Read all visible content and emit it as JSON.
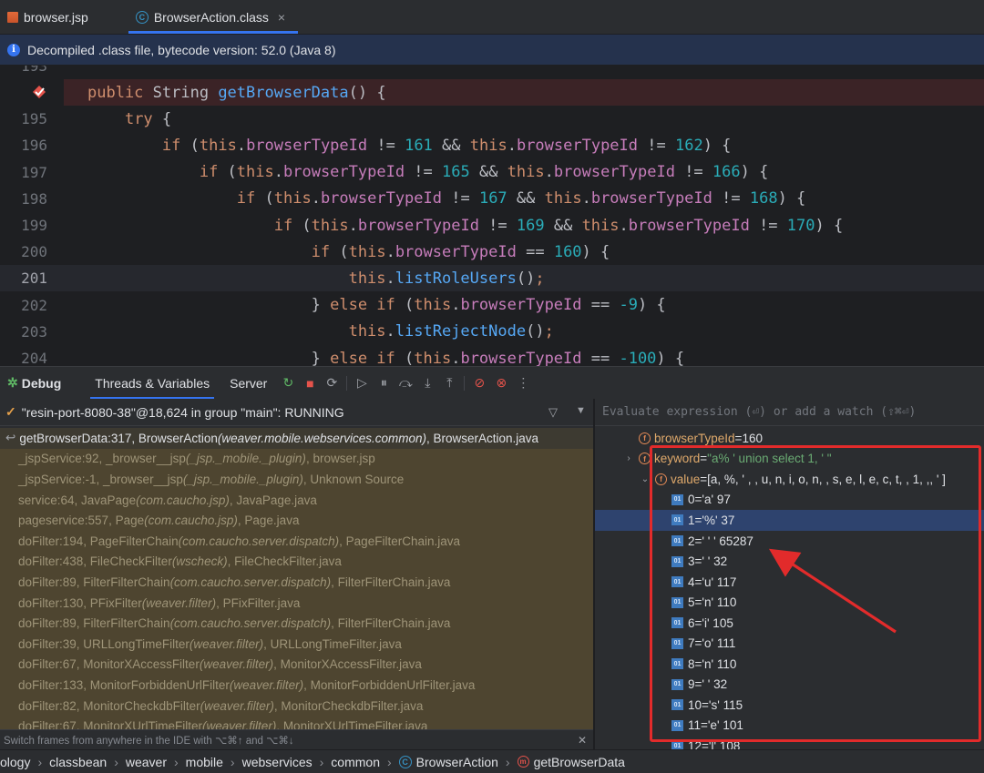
{
  "tabs": [
    {
      "label": "browser.jsp",
      "icon": "jsp-file-icon"
    },
    {
      "label": "BrowserAction.class",
      "icon": "class-icon",
      "active": true
    }
  ],
  "banner": {
    "text": "Decompiled .class file, bytecode version: 52.0 (Java 8)"
  },
  "editor": {
    "partial_top_number": "193",
    "lines": [
      {
        "num": "",
        "breakpoint": true,
        "tokens": [
          [
            "kw",
            "public "
          ],
          [
            "pl",
            "String "
          ],
          [
            "fn",
            "getBrowserData"
          ],
          [
            "pl",
            "() {"
          ]
        ]
      },
      {
        "num": "195",
        "tokens": [
          [
            "pl",
            "    "
          ],
          [
            "kw",
            "try "
          ],
          [
            "pl",
            "{"
          ]
        ]
      },
      {
        "num": "196",
        "tokens": [
          [
            "pl",
            "        "
          ],
          [
            "kw",
            "if "
          ],
          [
            "pl",
            "("
          ],
          [
            "kw",
            "this"
          ],
          [
            "pl",
            "."
          ],
          [
            "fld",
            "browserTypeId"
          ],
          [
            "pl",
            " != "
          ],
          [
            "num",
            "161"
          ],
          [
            "pl",
            " && "
          ],
          [
            "kw",
            "this"
          ],
          [
            "pl",
            "."
          ],
          [
            "fld",
            "browserTypeId"
          ],
          [
            "pl",
            " != "
          ],
          [
            "num",
            "162"
          ],
          [
            "pl",
            ") {"
          ]
        ]
      },
      {
        "num": "197",
        "tokens": [
          [
            "pl",
            "            "
          ],
          [
            "kw",
            "if "
          ],
          [
            "pl",
            "("
          ],
          [
            "kw",
            "this"
          ],
          [
            "pl",
            "."
          ],
          [
            "fld",
            "browserTypeId"
          ],
          [
            "pl",
            " != "
          ],
          [
            "num",
            "165"
          ],
          [
            "pl",
            " && "
          ],
          [
            "kw",
            "this"
          ],
          [
            "pl",
            "."
          ],
          [
            "fld",
            "browserTypeId"
          ],
          [
            "pl",
            " != "
          ],
          [
            "num",
            "166"
          ],
          [
            "pl",
            ") {"
          ]
        ]
      },
      {
        "num": "198",
        "tokens": [
          [
            "pl",
            "                "
          ],
          [
            "kw",
            "if "
          ],
          [
            "pl",
            "("
          ],
          [
            "kw",
            "this"
          ],
          [
            "pl",
            "."
          ],
          [
            "fld",
            "browserTypeId"
          ],
          [
            "pl",
            " != "
          ],
          [
            "num",
            "167"
          ],
          [
            "pl",
            " && "
          ],
          [
            "kw",
            "this"
          ],
          [
            "pl",
            "."
          ],
          [
            "fld",
            "browserTypeId"
          ],
          [
            "pl",
            " != "
          ],
          [
            "num",
            "168"
          ],
          [
            "pl",
            ") {"
          ]
        ]
      },
      {
        "num": "199",
        "tokens": [
          [
            "pl",
            "                    "
          ],
          [
            "kw",
            "if "
          ],
          [
            "pl",
            "("
          ],
          [
            "kw",
            "this"
          ],
          [
            "pl",
            "."
          ],
          [
            "fld",
            "browserTypeId"
          ],
          [
            "pl",
            " != "
          ],
          [
            "num",
            "169"
          ],
          [
            "pl",
            " && "
          ],
          [
            "kw",
            "this"
          ],
          [
            "pl",
            "."
          ],
          [
            "fld",
            "browserTypeId"
          ],
          [
            "pl",
            " != "
          ],
          [
            "num",
            "170"
          ],
          [
            "pl",
            ") {"
          ]
        ]
      },
      {
        "num": "200",
        "tokens": [
          [
            "pl",
            "                        "
          ],
          [
            "kw",
            "if "
          ],
          [
            "pl",
            "("
          ],
          [
            "kw",
            "this"
          ],
          [
            "pl",
            "."
          ],
          [
            "fld",
            "browserTypeId"
          ],
          [
            "pl",
            " == "
          ],
          [
            "num",
            "160"
          ],
          [
            "pl",
            ") {"
          ]
        ]
      },
      {
        "num": "201",
        "current": true,
        "tokens": [
          [
            "pl",
            "                            "
          ],
          [
            "kw",
            "this"
          ],
          [
            "pl",
            "."
          ],
          [
            "fn",
            "listRoleUsers"
          ],
          [
            "pl",
            "()"
          ],
          [
            "kw",
            ";"
          ]
        ]
      },
      {
        "num": "202",
        "tokens": [
          [
            "pl",
            "                        } "
          ],
          [
            "kw",
            "else if "
          ],
          [
            "pl",
            "("
          ],
          [
            "kw",
            "this"
          ],
          [
            "pl",
            "."
          ],
          [
            "fld",
            "browserTypeId"
          ],
          [
            "pl",
            " == "
          ],
          [
            "num",
            "-9"
          ],
          [
            "pl",
            ") {"
          ]
        ]
      },
      {
        "num": "203",
        "tokens": [
          [
            "pl",
            "                            "
          ],
          [
            "kw",
            "this"
          ],
          [
            "pl",
            "."
          ],
          [
            "fn",
            "listRejectNode"
          ],
          [
            "pl",
            "()"
          ],
          [
            "kw",
            ";"
          ]
        ]
      },
      {
        "num": "204",
        "tokens": [
          [
            "pl",
            "                        } "
          ],
          [
            "kw",
            "else if "
          ],
          [
            "pl",
            "("
          ],
          [
            "kw",
            "this"
          ],
          [
            "pl",
            "."
          ],
          [
            "fld",
            "browserTypeId"
          ],
          [
            "pl",
            " == "
          ],
          [
            "num",
            "-100"
          ],
          [
            "pl",
            ") {"
          ]
        ]
      }
    ]
  },
  "debugbar": {
    "title": "Debug",
    "tabs": [
      "Threads & Variables",
      "Server"
    ]
  },
  "thread": {
    "label": "\"resin-port-8080-38\"@18,624 in group \"main\": RUNNING"
  },
  "frames": [
    {
      "method": "getBrowserData:317, BrowserAction",
      "pkg": "(weaver.mobile.webservices.common)",
      "file": ", BrowserAction.java"
    },
    {
      "method": "_jspService:92, _browser__jsp",
      "pkg": "(_jsp._mobile._plugin)",
      "file": ", browser.jsp"
    },
    {
      "method": "_jspService:-1, _browser__jsp",
      "pkg": "(_jsp._mobile._plugin)",
      "file": ", Unknown Source"
    },
    {
      "method": "service:64, JavaPage",
      "pkg": "(com.caucho.jsp)",
      "file": ", JavaPage.java"
    },
    {
      "method": "pageservice:557, Page",
      "pkg": "(com.caucho.jsp)",
      "file": ", Page.java"
    },
    {
      "method": "doFilter:194, PageFilterChain",
      "pkg": "(com.caucho.server.dispatch)",
      "file": ", PageFilterChain.java"
    },
    {
      "method": "doFilter:438, FileCheckFilter",
      "pkg": "(wscheck)",
      "file": ", FileCheckFilter.java"
    },
    {
      "method": "doFilter:89, FilterFilterChain",
      "pkg": "(com.caucho.server.dispatch)",
      "file": ", FilterFilterChain.java"
    },
    {
      "method": "doFilter:130, PFixFilter",
      "pkg": "(weaver.filter)",
      "file": ", PFixFilter.java"
    },
    {
      "method": "doFilter:89, FilterFilterChain",
      "pkg": "(com.caucho.server.dispatch)",
      "file": ", FilterFilterChain.java"
    },
    {
      "method": "doFilter:39, URLLongTimeFilter",
      "pkg": "(weaver.filter)",
      "file": ", URLLongTimeFilter.java"
    },
    {
      "method": "doFilter:67, MonitorXAccessFilter",
      "pkg": "(weaver.filter)",
      "file": ", MonitorXAccessFilter.java"
    },
    {
      "method": "doFilter:133, MonitorForbiddenUrlFilter",
      "pkg": "(weaver.filter)",
      "file": ", MonitorForbiddenUrlFilter.java"
    },
    {
      "method": "doFilter:82, MonitorCheckdbFilter",
      "pkg": "(weaver.filter)",
      "file": ", MonitorCheckdbFilter.java"
    },
    {
      "method": "doFilter:67, MonitorXUrlTimeFilter",
      "pkg": "(weaver.filter)",
      "file": ", MonitorXUrlTimeFilter.java"
    }
  ],
  "hint": "Switch frames from anywhere in the IDE with ⌥⌘↑ and ⌥⌘↓",
  "variables": {
    "eval_placeholder": "Evaluate expression (⏎) or add a watch (⇧⌘⏎)",
    "items": [
      {
        "indent": 0,
        "chevron": "",
        "icon": "f",
        "name": "browserTypeId",
        "sep": " = ",
        "value": "160",
        "str": false
      },
      {
        "indent": 0,
        "chevron": "›",
        "icon": "f",
        "name": "keyword",
        "sep": " = ",
        "value": "\"a% '  union select 1, ' \"",
        "str": true
      },
      {
        "indent": 1,
        "chevron": "⌄",
        "icon": "f",
        "name": "value",
        "sep": " = ",
        "value": "[a, %,  ' ,  , u, n, i, o, n,  , s, e, l, e, c, t,  , 1, ,,  ' ]",
        "str": false
      },
      {
        "indent": 2,
        "chevron": "",
        "icon": "o",
        "name": "0",
        "sep": " = ",
        "value": "'a' 97",
        "str": false
      },
      {
        "indent": 2,
        "chevron": "",
        "icon": "o",
        "name": "1",
        "sep": " = ",
        "value": "'%' 37",
        "str": false,
        "selected": true
      },
      {
        "indent": 2,
        "chevron": "",
        "icon": "o",
        "name": "2",
        "sep": " = ",
        "value": "' ' ' 65287",
        "str": false
      },
      {
        "indent": 2,
        "chevron": "",
        "icon": "o",
        "name": "3",
        "sep": " = ",
        "value": "' ' 32",
        "str": false
      },
      {
        "indent": 2,
        "chevron": "",
        "icon": "o",
        "name": "4",
        "sep": " = ",
        "value": "'u' 117",
        "str": false
      },
      {
        "indent": 2,
        "chevron": "",
        "icon": "o",
        "name": "5",
        "sep": " = ",
        "value": "'n' 110",
        "str": false
      },
      {
        "indent": 2,
        "chevron": "",
        "icon": "o",
        "name": "6",
        "sep": " = ",
        "value": "'i' 105",
        "str": false
      },
      {
        "indent": 2,
        "chevron": "",
        "icon": "o",
        "name": "7",
        "sep": " = ",
        "value": "'o' 111",
        "str": false
      },
      {
        "indent": 2,
        "chevron": "",
        "icon": "o",
        "name": "8",
        "sep": " = ",
        "value": "'n' 110",
        "str": false
      },
      {
        "indent": 2,
        "chevron": "",
        "icon": "o",
        "name": "9",
        "sep": " = ",
        "value": "' ' 32",
        "str": false
      },
      {
        "indent": 2,
        "chevron": "",
        "icon": "o",
        "name": "10",
        "sep": " = ",
        "value": "'s' 115",
        "str": false
      },
      {
        "indent": 2,
        "chevron": "",
        "icon": "o",
        "name": "11",
        "sep": " = ",
        "value": "'e' 101",
        "str": false
      },
      {
        "indent": 2,
        "chevron": "",
        "icon": "o",
        "name": "12",
        "sep": " = ",
        "value": "'l' 108",
        "str": false
      }
    ]
  },
  "breadcrumb": [
    "ology",
    "classbean",
    "weaver",
    "mobile",
    "webservices",
    "common",
    "BrowserAction",
    "getBrowserData"
  ],
  "colors": {
    "accent": "#3574f0",
    "annotation": "#e22b2b",
    "frame_bg": "#4e4530"
  }
}
